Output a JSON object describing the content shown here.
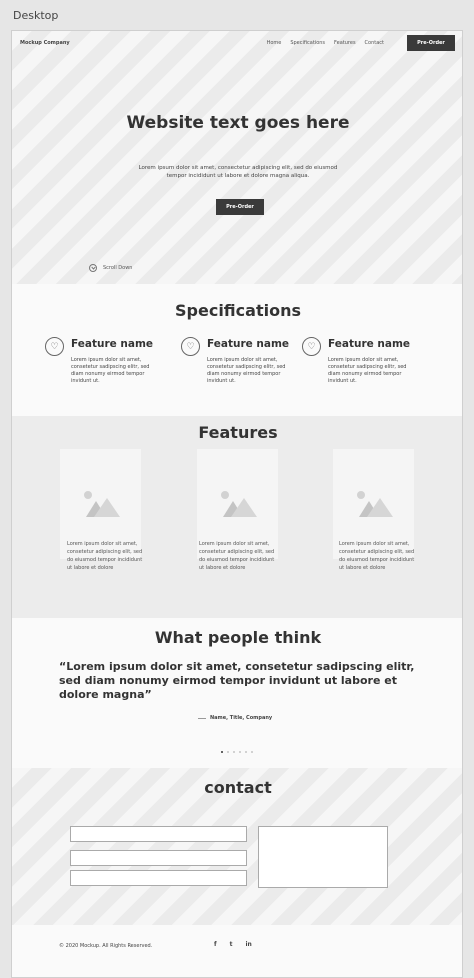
{
  "artboard": {
    "label": "Desktop"
  },
  "header": {
    "logo": "Mockup Company",
    "nav": [
      "Home",
      "Specifications",
      "Features",
      "Contact"
    ],
    "cta": "Pre-Order"
  },
  "hero": {
    "title": "Website text goes here",
    "subtitle": "Lorem ipsum dolor sit amet, consectetur adipiscing elit, sed do eiusmod tempor incididunt ut labore et dolore magna aliqua.",
    "cta": "Pre-Order",
    "scroll": "Scroll Down"
  },
  "specifications": {
    "title": "Specifications",
    "items": [
      {
        "name": "Feature name",
        "text": "Lorem ipsum dolor sit amet, consetetur sadipscing elitr, sed diam nonumy eirmod tempor invidunt ut."
      },
      {
        "name": "Feature name",
        "text": "Lorem ipsum dolor sit amet, consetetur sadipscing elitr, sed diam nonumy eirmod tempor invidunt ut."
      },
      {
        "name": "Feature name",
        "text": "Lorem ipsum dolor sit amet, consetetur sadipscing elitr, sed diam nonumy eirmod tempor invidunt ut."
      }
    ]
  },
  "features": {
    "title": "Features",
    "items": [
      {
        "text": "Lorem ipsum dolor sit amet, consetetur adipiscing elit, sed do eiusmod tempor incididunt ut labore et dolore"
      },
      {
        "text": "Lorem ipsum dolor sit amet, consetetur adipiscing elit, sed do eiusmod tempor incididunt ut labore et dolore"
      },
      {
        "text": "Lorem ipsum dolor sit amet, consetetur adipiscing elit, sed do eiusmod tempor incididunt ut labore et dolore"
      }
    ]
  },
  "testimonial": {
    "title": "What people think",
    "quote": "“Lorem ipsum dolor sit amet, consetetur sadipscing elitr, sed diam nonumy eirmod tempor invidunt ut labore et dolore magna”",
    "author": "Name, Title, Company",
    "slide_count": 6,
    "active_slide": 1
  },
  "contact": {
    "title": "contact"
  },
  "footer": {
    "copyright": "© 2020 Mockup.  All Rights Reserved.",
    "social": [
      {
        "icon": "facebook-icon",
        "glyph": "f"
      },
      {
        "icon": "twitter-icon",
        "glyph": "t"
      },
      {
        "icon": "linkedin-icon",
        "glyph": "in"
      }
    ]
  },
  "colors": {
    "dark": "#3a3a3a",
    "panel_light": "#fafafa",
    "panel_gray": "#ececec"
  }
}
